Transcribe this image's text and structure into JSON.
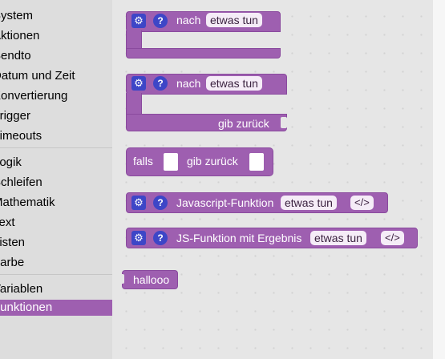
{
  "sidebar": {
    "items": [
      {
        "label": "System"
      },
      {
        "label": "Aktionen"
      },
      {
        "label": "Sendto"
      },
      {
        "label": "Datum und Zeit"
      },
      {
        "label": "Konvertierung"
      },
      {
        "label": "Trigger"
      },
      {
        "label": "Timeouts"
      },
      {
        "label": "Logik"
      },
      {
        "label": "Schleifen"
      },
      {
        "label": "Mathematik"
      },
      {
        "label": "Text"
      },
      {
        "label": "Listen"
      },
      {
        "label": "Farbe"
      },
      {
        "label": "Variablen"
      },
      {
        "label": "Funktionen"
      }
    ],
    "selected": "Funktionen"
  },
  "blocks": {
    "procedure": {
      "label": "nach",
      "name": "etwas tun"
    },
    "procedure_return": {
      "label": "nach",
      "name": "etwas tun",
      "return_label": "gib zurück"
    },
    "if_return": {
      "if_label": "falls",
      "return_label": "gib zurück"
    },
    "js_function": {
      "label": "Javascript-Funktion",
      "name": "etwas tun",
      "code": "</>"
    },
    "js_function_result": {
      "label": "JS-Funktion mit Ergebnis",
      "name": "etwas tun",
      "code": "</>"
    },
    "call": {
      "label": "hallooo"
    }
  },
  "icons": {
    "gear": "⚙",
    "help": "?"
  },
  "colors": {
    "block": "#9e5fb0",
    "icon": "#3d46c7",
    "selected": "#9e5fb0"
  }
}
